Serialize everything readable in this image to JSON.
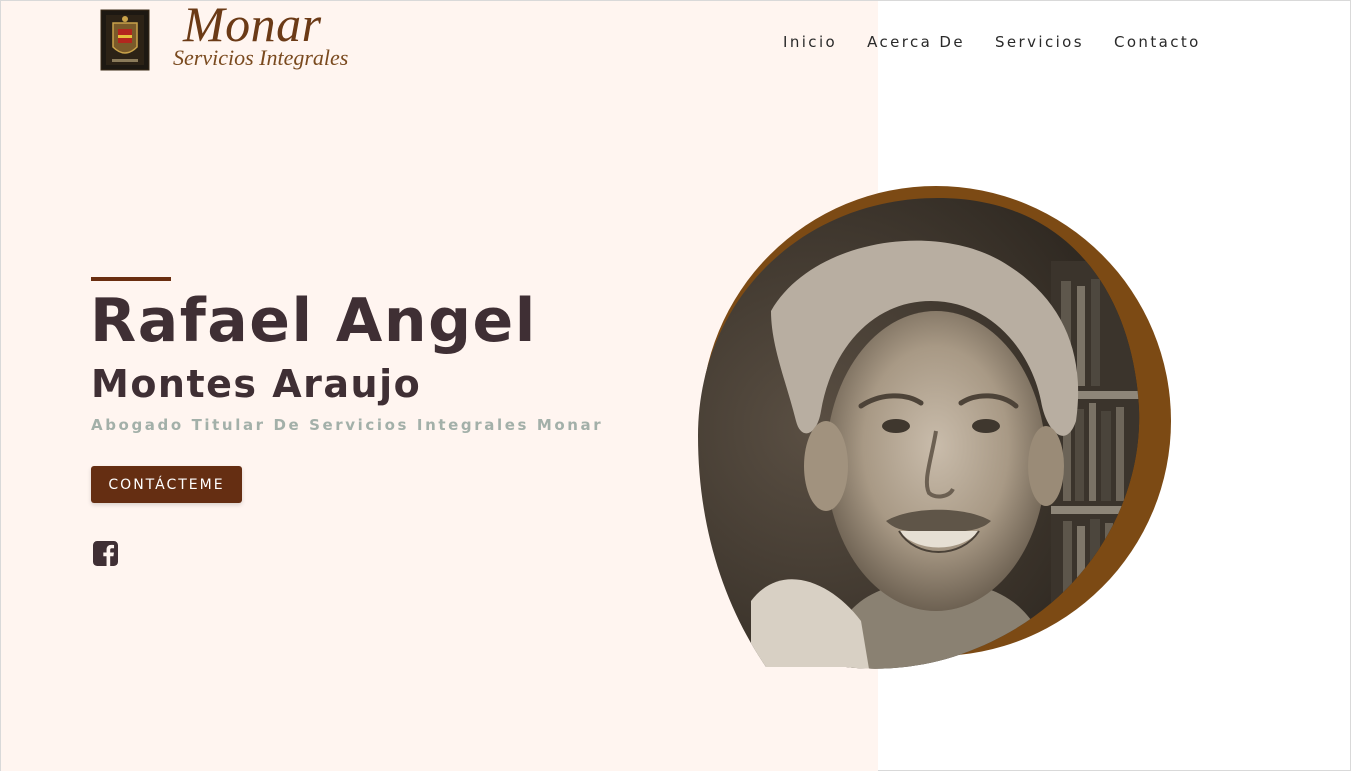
{
  "brand": {
    "name": "Monar",
    "tagline": "Servicios Integrales",
    "crest_icon": "coat-of-arms-crest",
    "color": "#6b3a16"
  },
  "nav": {
    "items": [
      {
        "label": "Inicio"
      },
      {
        "label": "Acerca De"
      },
      {
        "label": "Servicios"
      },
      {
        "label": "Contacto"
      }
    ]
  },
  "hero": {
    "first_name": "Rafael Angel",
    "last_name": "Montes Araujo",
    "role": "Abogado Titular De Servicios Integrales Monar",
    "cta_label": "CONTÁCTEME",
    "social_icon": "facebook-square-icon",
    "portrait_icon": "portrait-photo"
  },
  "colors": {
    "panel_bg": "#fff5f0",
    "heading": "#3f2f34",
    "accent": "#6a2e10",
    "button": "#652e12",
    "ring": "#7c4a14",
    "role_text": "#a3b0a9"
  }
}
